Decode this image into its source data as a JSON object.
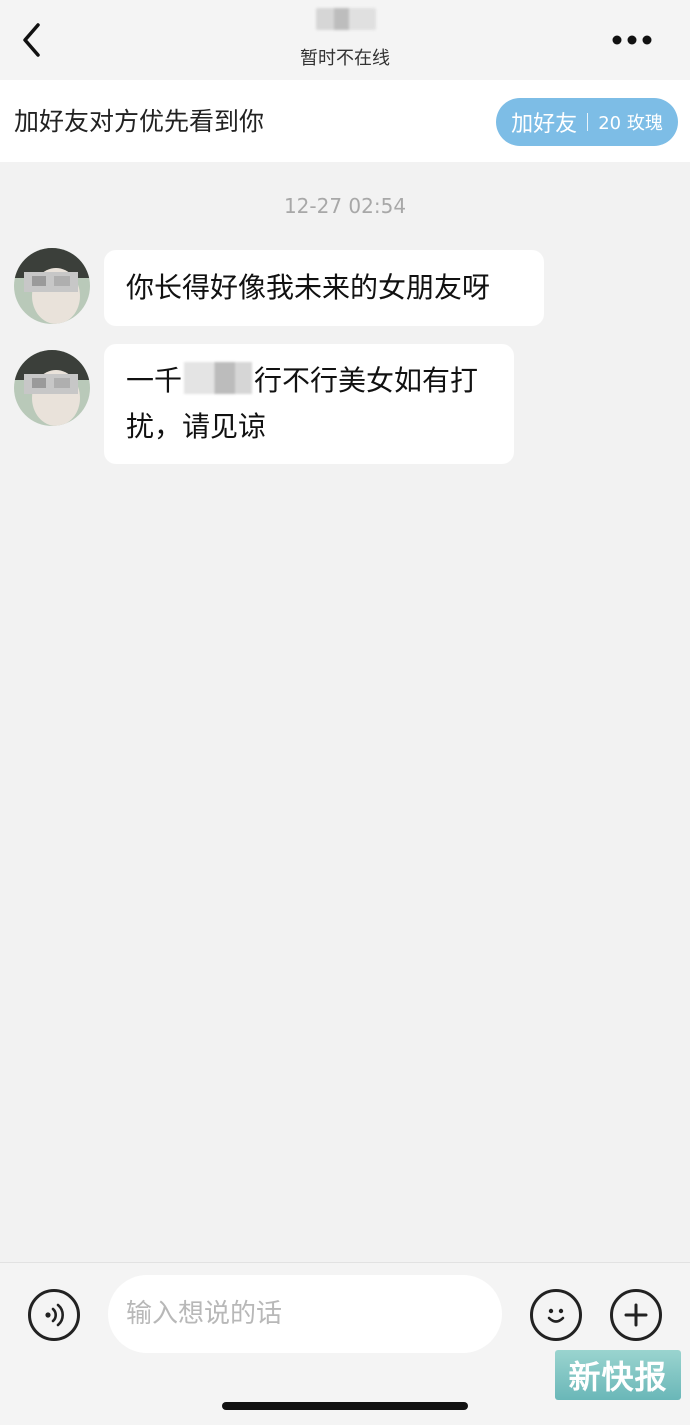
{
  "nav": {
    "status": "暂时不在线"
  },
  "banner": {
    "text": "加好友对方优先看到你",
    "add_button": {
      "label": "加好友",
      "price": "20 玫瑰"
    }
  },
  "chat": {
    "timestamp": "12-27 02:54",
    "messages": [
      {
        "text": "你长得好像我未来的女朋友呀"
      },
      {
        "text_before": "一千",
        "text_after": "行不行美女如有打扰，请见谅"
      }
    ]
  },
  "input": {
    "placeholder": "输入想说的话"
  },
  "watermark": "新快报",
  "colors": {
    "accent": "#7dbde6",
    "background": "#f2f2f2",
    "bubble": "#ffffff"
  },
  "icons": [
    "back-arrow-icon",
    "more-dots-icon",
    "voice-icon",
    "emoji-icon",
    "plus-icon"
  ]
}
